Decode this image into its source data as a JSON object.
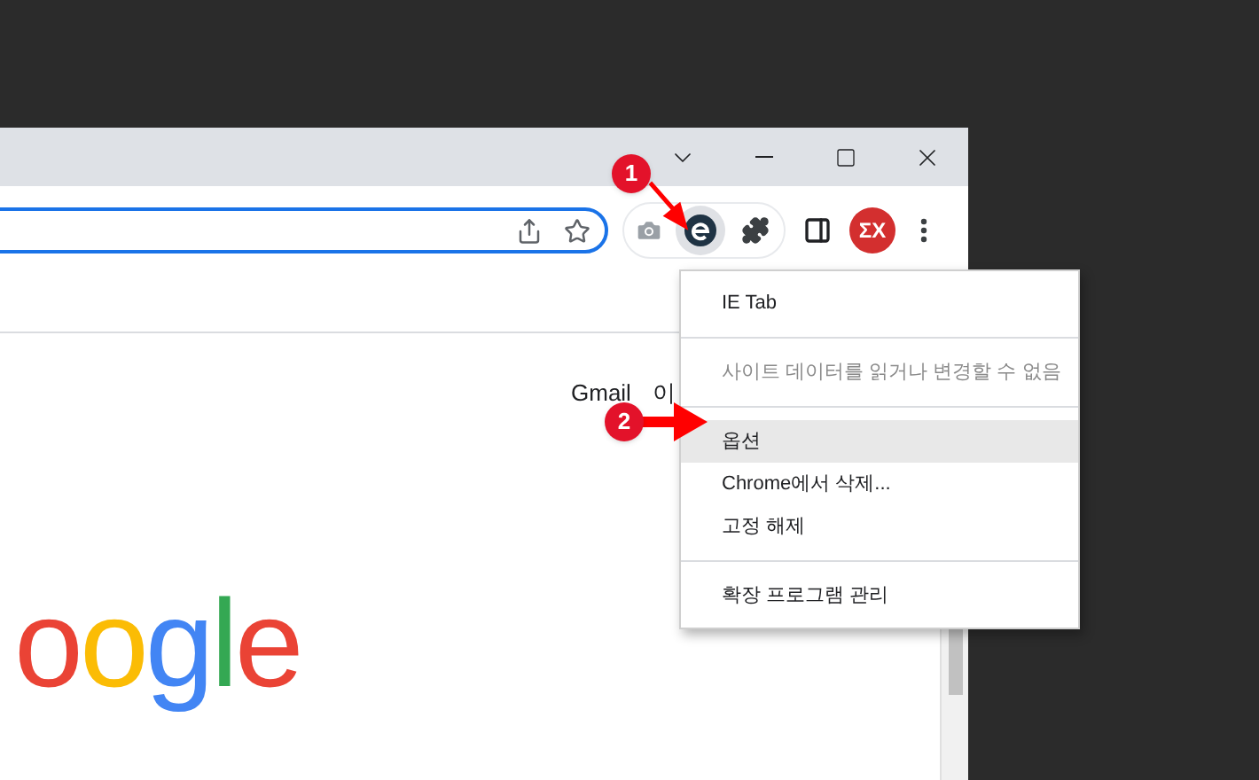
{
  "title_bar": {
    "controls": [
      {
        "kind": "tabs"
      },
      {
        "kind": "minimize"
      },
      {
        "kind": "maximize"
      },
      {
        "kind": "close"
      }
    ]
  },
  "toolbar": {
    "address_bar": {
      "focused": true
    },
    "extensions": [
      {
        "kind": "camera",
        "selected": false
      },
      {
        "kind": "ietab",
        "selected": true
      },
      {
        "kind": "puzzle",
        "selected": false
      }
    ],
    "profile": {
      "initials": "ΣX"
    }
  },
  "page": {
    "links": [
      "Gmail",
      "이"
    ],
    "logo": [
      {
        "text": "o",
        "color": "#ea4335"
      },
      {
        "text": "o",
        "color": "#fbbc05"
      },
      {
        "text": "g",
        "color": "#4285f4"
      },
      {
        "text": "l",
        "color": "#34a853"
      },
      {
        "text": "e",
        "color": "#ea4335"
      }
    ]
  },
  "menu": {
    "items": [
      {
        "kind": "item",
        "label": "IE Tab",
        "disabled": false,
        "selected": false
      },
      {
        "kind": "divider"
      },
      {
        "kind": "item",
        "label": "사이트 데이터를 읽거나 변경할 수 없음",
        "disabled": true,
        "selected": false
      },
      {
        "kind": "divider"
      },
      {
        "kind": "item",
        "label": "옵션",
        "disabled": false,
        "selected": true
      },
      {
        "kind": "item",
        "label": "Chrome에서 삭제...",
        "disabled": false,
        "selected": false
      },
      {
        "kind": "item",
        "label": "고정 해제",
        "disabled": false,
        "selected": false
      },
      {
        "kind": "divider"
      },
      {
        "kind": "item",
        "label": "확장 프로그램 관리",
        "disabled": false,
        "selected": false
      }
    ]
  },
  "callouts": [
    {
      "number": "1"
    },
    {
      "number": "2"
    }
  ]
}
